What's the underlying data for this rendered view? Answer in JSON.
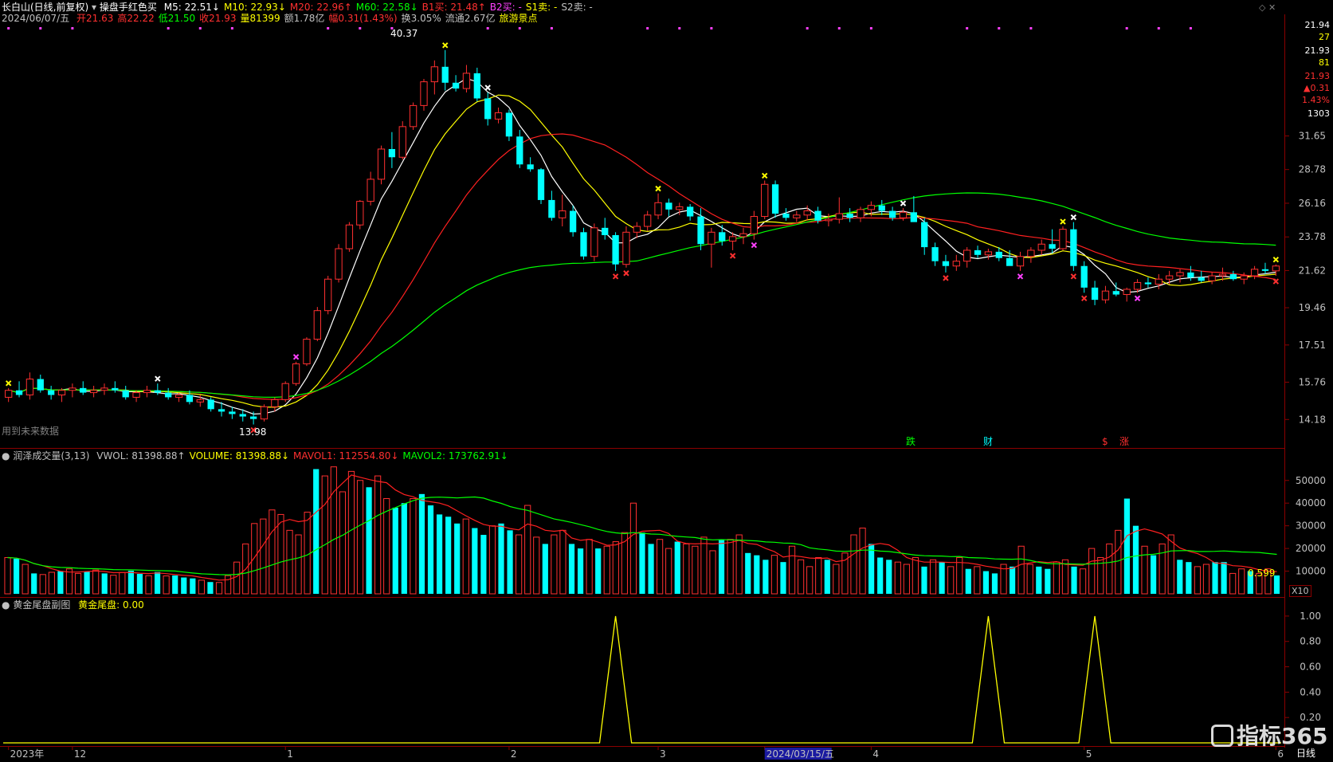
{
  "header": {
    "stock_title": "长白山(日线,前复权)",
    "indicator_name": "操盘手红色买",
    "ma": [
      {
        "label": "M5: 22.51",
        "arrow": "↓",
        "color": "#ffffff"
      },
      {
        "label": "M10: 22.93",
        "arrow": "↓",
        "color": "#ffff00"
      },
      {
        "label": "M20: 22.96",
        "arrow": "↑",
        "color": "#ff3030"
      },
      {
        "label": "M60: 22.58",
        "arrow": "↓",
        "color": "#00ff00"
      },
      {
        "label": "B1买: 21.48",
        "arrow": "↑",
        "color": "#ff3030"
      },
      {
        "label": "B2买: -",
        "arrow": "",
        "color": "#ff40ff"
      },
      {
        "label": "S1卖: -",
        "arrow": "",
        "color": "#ffff00"
      },
      {
        "label": "S2卖: -",
        "arrow": "",
        "color": "#c0c0c0"
      }
    ],
    "date": "2024/06/07/五",
    "ohlc": [
      {
        "label": "开21.63",
        "color": "#ff3030"
      },
      {
        "label": "高22.22",
        "color": "#ff3030"
      },
      {
        "label": "低21.50",
        "color": "#00ff00"
      },
      {
        "label": "收21.93",
        "color": "#ff3030"
      },
      {
        "label": "量81399",
        "color": "#ffff00"
      },
      {
        "label": "额1.78亿",
        "color": "#c0c0c0"
      },
      {
        "label": "幅0.31(1.43%)",
        "color": "#ff3030"
      },
      {
        "label": "换3.05%",
        "color": "#c0c0c0"
      },
      {
        "label": "流通2.67亿",
        "color": "#c0c0c0"
      },
      {
        "label": "旅游景点",
        "color": "#ffff00"
      }
    ]
  },
  "volume_header": {
    "title": "润泽成交量(3,13)",
    "items": [
      {
        "label": "VWOL: 81398.88",
        "arrow": "↑",
        "color": "#c0c0c0"
      },
      {
        "label": "VOLUME: 81398.88",
        "arrow": "↓",
        "color": "#ffff00"
      },
      {
        "label": "MAVOL1: 112554.80",
        "arrow": "↓",
        "color": "#ff3030"
      },
      {
        "label": "MAVOL2: 173762.91",
        "arrow": "↓",
        "color": "#00ff00"
      }
    ]
  },
  "sub_header": {
    "title": "黄金尾盘副图",
    "value": "黄金尾盘: 0.00"
  },
  "right_panel": {
    "items": [
      "21.94",
      "27",
      "21.93",
      "81",
      "21.93",
      "▲0.31",
      "1.43%",
      "1303"
    ]
  },
  "annotations": {
    "high_label": "40.37",
    "low_label": "13.98",
    "future_label": "用到未来数据",
    "vol_last": "0.599",
    "vol_unit": "X10",
    "events": [
      "跌",
      "财",
      "$",
      "涨"
    ],
    "bottom_right": "日线",
    "watermark": "指标365"
  },
  "colors": {
    "up": "#ff3030",
    "down": "#00ffff",
    "ma5": "#ffffff",
    "ma10": "#ffff00",
    "ma20": "#ff2020",
    "ma60": "#00ff00",
    "border": "#8b0000",
    "axis_text": "#c0c0c0"
  },
  "chart_data": [
    {
      "type": "candlestick",
      "yticks": [
        14.18,
        15.76,
        17.51,
        19.46,
        21.62,
        23.78,
        26.16,
        28.78,
        31.65
      ],
      "ylim": [
        13.2,
        42.5
      ],
      "x_axis_labels": [
        {
          "label": "2023年",
          "index": 0
        },
        {
          "label": "12",
          "index": 6
        },
        {
          "label": "1",
          "index": 26
        },
        {
          "label": "2",
          "index": 47
        },
        {
          "label": "3",
          "index": 61
        },
        {
          "label": "2024/03/15/五",
          "index": 71
        },
        {
          "label": "4",
          "index": 81
        },
        {
          "label": "5",
          "index": 101
        },
        {
          "label": "6",
          "index": 119
        }
      ],
      "ohlc": [
        [
          15.1,
          15.5,
          14.9,
          15.4
        ],
        [
          15.4,
          15.8,
          15.1,
          15.2
        ],
        [
          15.2,
          16.2,
          15.0,
          15.9
        ],
        [
          15.9,
          16.1,
          15.3,
          15.4
        ],
        [
          15.4,
          15.6,
          15.0,
          15.2
        ],
        [
          15.2,
          15.5,
          14.9,
          15.4
        ],
        [
          15.4,
          15.7,
          15.1,
          15.5
        ],
        [
          15.5,
          15.8,
          15.2,
          15.3
        ],
        [
          15.3,
          15.6,
          15.1,
          15.4
        ],
        [
          15.4,
          15.7,
          15.2,
          15.5
        ],
        [
          15.5,
          15.8,
          15.3,
          15.4
        ],
        [
          15.4,
          15.6,
          15.0,
          15.1
        ],
        [
          15.1,
          15.4,
          14.9,
          15.3
        ],
        [
          15.3,
          15.6,
          15.1,
          15.4
        ],
        [
          15.4,
          15.7,
          15.2,
          15.3
        ],
        [
          15.3,
          15.5,
          15.0,
          15.1
        ],
        [
          15.1,
          15.3,
          14.9,
          15.2
        ],
        [
          15.2,
          15.4,
          14.8,
          14.9
        ],
        [
          14.9,
          15.2,
          14.7,
          15.0
        ],
        [
          15.0,
          15.1,
          14.5,
          14.6
        ],
        [
          14.6,
          14.9,
          14.3,
          14.5
        ],
        [
          14.5,
          14.7,
          14.2,
          14.4
        ],
        [
          14.4,
          14.6,
          14.1,
          14.3
        ],
        [
          14.3,
          14.5,
          13.98,
          14.2
        ],
        [
          14.2,
          14.8,
          14.1,
          14.7
        ],
        [
          14.7,
          15.1,
          14.5,
          15.0
        ],
        [
          15.0,
          15.8,
          14.9,
          15.7
        ],
        [
          15.7,
          16.7,
          15.6,
          16.6
        ],
        [
          16.6,
          17.9,
          16.5,
          17.8
        ],
        [
          17.8,
          19.5,
          17.7,
          19.3
        ],
        [
          19.3,
          21.3,
          19.1,
          21.1
        ],
        [
          21.1,
          23.3,
          20.9,
          23.0
        ],
        [
          23.0,
          24.8,
          22.8,
          24.6
        ],
        [
          24.6,
          26.4,
          24.3,
          26.3
        ],
        [
          26.3,
          28.6,
          26.0,
          28.0
        ],
        [
          28.0,
          30.8,
          27.6,
          30.5
        ],
        [
          30.5,
          32.0,
          28.9,
          29.8
        ],
        [
          29.8,
          33.0,
          29.6,
          32.5
        ],
        [
          32.5,
          34.8,
          32.2,
          34.5
        ],
        [
          34.5,
          37.2,
          34.0,
          36.9
        ],
        [
          36.9,
          39.2,
          35.6,
          38.5
        ],
        [
          38.5,
          40.37,
          36.0,
          36.8
        ],
        [
          36.8,
          37.6,
          35.9,
          36.2
        ],
        [
          36.2,
          38.7,
          35.8,
          37.8
        ],
        [
          37.8,
          38.4,
          34.9,
          35.2
        ],
        [
          35.2,
          35.8,
          32.6,
          33.2
        ],
        [
          33.2,
          34.3,
          32.8,
          33.8
        ],
        [
          33.8,
          34.1,
          31.2,
          31.6
        ],
        [
          31.6,
          32.2,
          28.9,
          29.2
        ],
        [
          29.2,
          29.8,
          28.6,
          28.8
        ],
        [
          28.8,
          28.9,
          26.1,
          26.4
        ],
        [
          26.4,
          27.1,
          24.9,
          25.1
        ],
        [
          25.1,
          26.8,
          24.5,
          25.6
        ],
        [
          25.6,
          26.0,
          23.8,
          24.1
        ],
        [
          24.1,
          24.4,
          22.3,
          22.5
        ],
        [
          22.5,
          24.7,
          22.2,
          24.4
        ],
        [
          24.4,
          25.1,
          23.6,
          23.9
        ],
        [
          23.9,
          24.1,
          21.6,
          22.0
        ],
        [
          22.0,
          24.5,
          21.8,
          24.1
        ],
        [
          24.1,
          24.8,
          23.7,
          24.5
        ],
        [
          24.5,
          25.6,
          24.2,
          25.3
        ],
        [
          25.3,
          26.9,
          25.0,
          26.2
        ],
        [
          26.2,
          26.5,
          25.2,
          25.7
        ],
        [
          25.7,
          26.2,
          25.3,
          25.9
        ],
        [
          25.9,
          26.1,
          24.9,
          25.2
        ],
        [
          25.2,
          25.8,
          22.9,
          23.3
        ],
        [
          23.3,
          24.4,
          21.8,
          24.1
        ],
        [
          24.1,
          24.6,
          23.2,
          23.5
        ],
        [
          23.5,
          24.1,
          22.9,
          23.8
        ],
        [
          23.8,
          24.4,
          23.3,
          24.0
        ],
        [
          24.0,
          25.6,
          23.6,
          25.2
        ],
        [
          25.2,
          27.9,
          25.0,
          27.6
        ],
        [
          27.6,
          27.9,
          25.1,
          25.4
        ],
        [
          25.4,
          25.8,
          24.9,
          25.1
        ],
        [
          25.1,
          25.6,
          24.8,
          25.3
        ],
        [
          25.3,
          26.0,
          24.9,
          25.6
        ],
        [
          25.6,
          25.9,
          24.7,
          24.9
        ],
        [
          24.9,
          25.4,
          24.5,
          25.0
        ],
        [
          25.0,
          26.6,
          24.7,
          25.4
        ],
        [
          25.4,
          25.8,
          24.8,
          25.1
        ],
        [
          25.1,
          25.9,
          24.8,
          25.7
        ],
        [
          25.7,
          26.3,
          25.2,
          26.0
        ],
        [
          26.0,
          26.4,
          25.3,
          25.6
        ],
        [
          25.6,
          25.9,
          24.9,
          25.1
        ],
        [
          25.1,
          25.8,
          24.9,
          25.5
        ],
        [
          25.5,
          26.7,
          25.1,
          24.8
        ],
        [
          24.8,
          25.1,
          22.6,
          23.1
        ],
        [
          23.1,
          23.4,
          21.9,
          22.2
        ],
        [
          22.2,
          22.6,
          21.5,
          21.9
        ],
        [
          21.9,
          22.6,
          21.6,
          22.2
        ],
        [
          22.2,
          23.1,
          21.8,
          22.9
        ],
        [
          22.9,
          23.2,
          22.4,
          22.6
        ],
        [
          22.6,
          23.0,
          22.3,
          22.8
        ],
        [
          22.8,
          23.1,
          22.2,
          22.4
        ],
        [
          22.4,
          22.9,
          22.0,
          21.9
        ],
        [
          21.9,
          22.8,
          21.6,
          22.5
        ],
        [
          22.5,
          23.1,
          22.1,
          22.9
        ],
        [
          22.9,
          23.6,
          22.6,
          23.3
        ],
        [
          23.3,
          24.3,
          22.7,
          23.0
        ],
        [
          23.0,
          24.5,
          22.9,
          24.3
        ],
        [
          24.3,
          24.8,
          21.6,
          21.9
        ],
        [
          21.9,
          22.2,
          20.3,
          20.6
        ],
        [
          20.6,
          21.0,
          19.6,
          19.9
        ],
        [
          19.9,
          20.7,
          19.7,
          20.4
        ],
        [
          20.4,
          20.9,
          20.1,
          20.2
        ],
        [
          20.2,
          20.6,
          19.8,
          20.5
        ],
        [
          20.5,
          21.1,
          20.3,
          20.9
        ],
        [
          20.9,
          21.2,
          20.6,
          20.8
        ],
        [
          20.8,
          21.4,
          20.5,
          21.1
        ],
        [
          21.1,
          21.6,
          20.8,
          21.3
        ],
        [
          21.3,
          21.7,
          20.9,
          21.5
        ],
        [
          21.5,
          21.9,
          21.0,
          21.2
        ],
        [
          21.2,
          21.6,
          20.9,
          21.0
        ],
        [
          21.0,
          21.5,
          20.8,
          21.3
        ],
        [
          21.3,
          21.8,
          21.0,
          21.4
        ],
        [
          21.4,
          21.6,
          21.0,
          21.1
        ],
        [
          21.1,
          21.5,
          20.8,
          21.3
        ],
        [
          21.3,
          21.9,
          21.1,
          21.7
        ],
        [
          21.7,
          22.1,
          21.4,
          21.6
        ],
        [
          21.6,
          22.0,
          21.3,
          21.9
        ]
      ],
      "series": [
        {
          "name": "M5",
          "color": "#ffffff"
        },
        {
          "name": "M10",
          "color": "#ffff00"
        },
        {
          "name": "M20",
          "color": "#ff2020"
        },
        {
          "name": "M60",
          "color": "#00ff00"
        }
      ]
    },
    {
      "type": "bar",
      "yticks": [
        10000,
        20000,
        30000,
        40000,
        50000
      ],
      "ylim": [
        0,
        58000
      ],
      "values": [
        16000,
        15500,
        13000,
        9000,
        8500,
        9500,
        10000,
        11000,
        9000,
        9800,
        10500,
        9000,
        8200,
        9400,
        10200,
        8800,
        8000,
        9600,
        7900,
        8100,
        7200,
        6800,
        6000,
        5200,
        5000,
        8000,
        14000,
        22000,
        31000,
        33000,
        37000,
        35000,
        28000,
        26000,
        36000,
        55000,
        52000,
        56000,
        45000,
        54000,
        50000,
        47000,
        52000,
        42000,
        38000,
        40000,
        42000,
        44000,
        39000,
        35000,
        34000,
        31000,
        33000,
        29000,
        26000,
        30000,
        31000,
        28000,
        26000,
        39000,
        25000,
        22000,
        26000,
        28000,
        22000,
        20000,
        24000,
        20000,
        21000,
        23000,
        27000,
        40000,
        27000,
        22000,
        24000,
        20000,
        23000,
        22000,
        21000,
        25000,
        19000,
        24000,
        24000,
        26000,
        18000,
        17000,
        15000,
        17000,
        14000,
        21000,
        15000,
        12000,
        16000,
        15000,
        13000,
        18000,
        26000,
        29000,
        22000,
        16000,
        15000,
        14000,
        13000,
        16000,
        12000,
        15000,
        14000,
        12000,
        16000,
        11000,
        12000,
        10000,
        9000,
        13000,
        12000,
        21000,
        13000,
        12000,
        11000,
        14000,
        15000,
        12000,
        11000,
        20000,
        16000,
        22000,
        28000,
        42000,
        30000,
        21000,
        17000,
        22000,
        26000,
        15000,
        14000,
        12000,
        13000,
        14000,
        14000,
        9000,
        11000,
        10000,
        9000,
        11000,
        8100
      ],
      "up_flags": [
        1,
        0,
        1,
        0,
        1,
        1,
        0,
        1,
        1,
        0,
        1,
        0,
        1,
        1,
        0,
        0,
        1,
        0,
        1,
        0,
        0,
        0,
        1,
        0,
        1,
        1,
        1,
        1,
        1,
        1,
        1,
        1,
        1,
        1,
        1,
        0,
        1,
        1,
        1,
        1,
        1,
        0,
        1,
        1,
        0,
        0,
        1,
        0,
        0,
        0,
        0,
        0,
        1,
        0,
        0,
        1,
        0,
        0,
        1,
        1,
        1,
        0,
        1,
        1,
        0,
        0,
        1,
        0,
        1,
        1,
        1,
        1,
        0,
        0,
        1,
        1,
        0,
        1,
        1,
        1,
        1,
        0,
        1,
        1,
        0,
        0,
        0,
        1,
        0,
        1,
        1,
        1,
        1,
        0,
        1,
        1,
        1,
        1,
        0,
        0,
        0,
        1,
        1,
        1,
        0,
        1,
        0,
        1,
        1,
        0,
        1,
        0,
        0,
        1,
        0,
        1,
        1,
        0,
        0,
        1,
        1,
        0,
        1,
        1,
        1,
        1,
        1,
        0,
        0,
        1,
        0,
        1,
        1,
        0,
        0,
        1,
        1,
        0,
        0,
        1,
        1,
        0,
        1,
        1,
        0
      ]
    },
    {
      "type": "line",
      "yticks": [
        0.2,
        0.4,
        0.6,
        0.8,
        1.0
      ],
      "ylim": [
        0,
        1.1
      ],
      "spikes_at_index": [
        57,
        92,
        102
      ],
      "series": [
        {
          "color": "#ffff00"
        }
      ]
    }
  ]
}
